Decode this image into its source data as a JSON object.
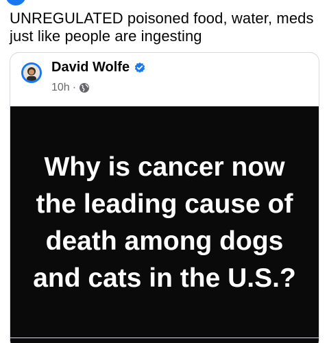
{
  "post": {
    "text": "UNREGULATED poisoned food, water, meds just like people are ingesting"
  },
  "shared_post": {
    "author": "David Wolfe",
    "timestamp": "10h",
    "separator": "·",
    "verified_icon": "verified-badge-icon",
    "privacy_icon": "globe-icon",
    "image_text": "Why is cancer now the leading cause of death among dogs and cats in the U.S.?"
  },
  "colors": {
    "accent": "#1877f2",
    "image_background": "#0a0a0a",
    "meta_text": "#65676b"
  }
}
